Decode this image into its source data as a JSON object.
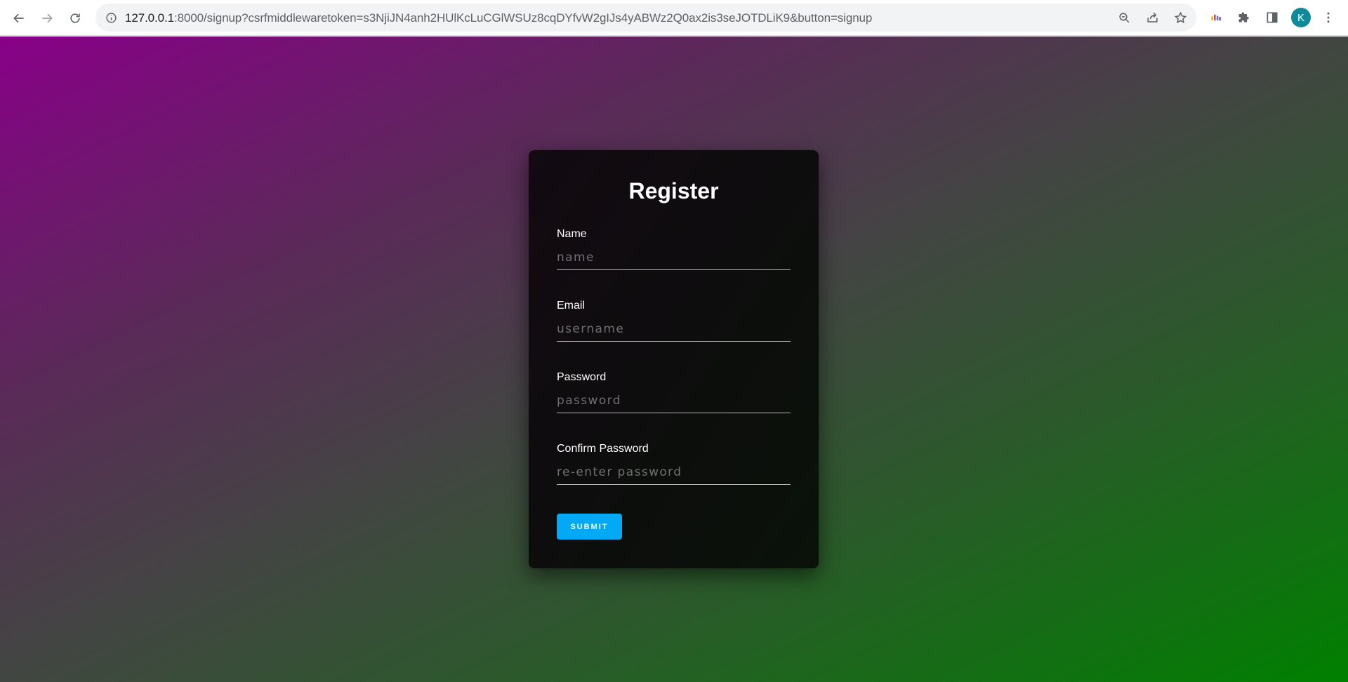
{
  "browser": {
    "url_host": "127.0.0.1",
    "url_rest": ":8000/signup?csrfmiddlewaretoken=s3NjiJN4anh2HUlKcLuCGlWSUz8cqDYfvW2gIJs4yABWz2Q0ax2is3seJOTDLiK9&button=signup",
    "profile_initial": "K",
    "avatar_color": "#0e8a98"
  },
  "form": {
    "title": "Register",
    "fields": [
      {
        "label": "Name",
        "placeholder": "name",
        "value": ""
      },
      {
        "label": "Email",
        "placeholder": "username",
        "value": ""
      },
      {
        "label": "Password",
        "placeholder": "password",
        "value": ""
      },
      {
        "label": "Confirm Password",
        "placeholder": "re-enter password",
        "value": ""
      }
    ],
    "submit_label": "SUBMIT",
    "submit_color": "#03a9f4"
  },
  "background": {
    "gradient_start": "#880088",
    "gradient_end": "#008000"
  }
}
